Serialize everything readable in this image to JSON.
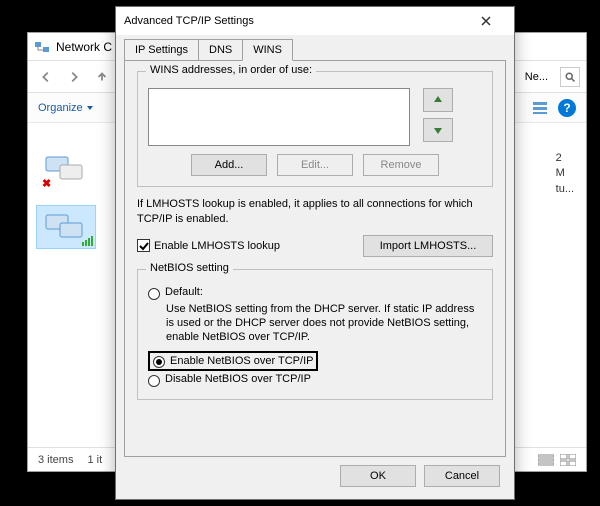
{
  "parent": {
    "title": "Network C",
    "organize": "Organize",
    "addr_tail": "Ne...",
    "right_panel": {
      "l1": "2",
      "l2": "M",
      "l3": "tu..."
    },
    "status_items": "3 items",
    "status_sel": "1 it"
  },
  "dialog": {
    "title": "Advanced TCP/IP Settings",
    "tabs": {
      "ip": "IP Settings",
      "dns": "DNS",
      "wins": "WINS"
    },
    "wins_label": "WINS addresses, in order of use:",
    "buttons": {
      "add": "Add...",
      "edit": "Edit...",
      "remove": "Remove"
    },
    "lmhosts_info": "If LMHOSTS lookup is enabled, it applies to all connections for which TCP/IP is enabled.",
    "enable_lmhosts": "Enable LMHOSTS lookup",
    "import_lmhosts": "Import LMHOSTS...",
    "netbios": {
      "group": "NetBIOS setting",
      "default": "Default:",
      "default_desc": "Use NetBIOS setting from the DHCP server. If static IP address is used or the DHCP server does not provide NetBIOS setting, enable NetBIOS over TCP/IP.",
      "enable": "Enable NetBIOS over TCP/IP",
      "disable": "Disable NetBIOS over TCP/IP"
    },
    "ok": "OK",
    "cancel": "Cancel"
  }
}
